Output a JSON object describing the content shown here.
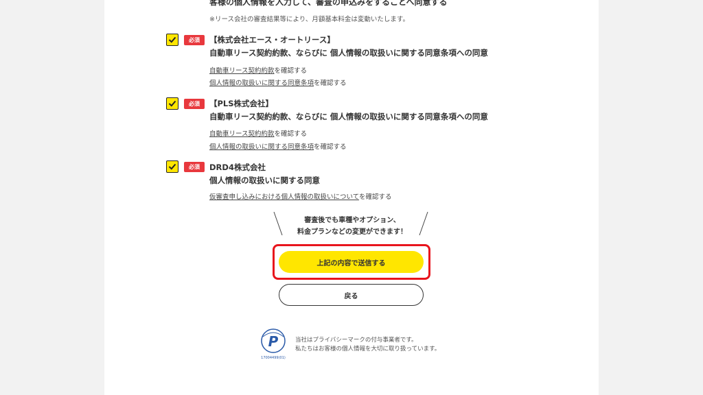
{
  "intro": {
    "line": "客様の個人情報を入力して、審査の申込みをすることへ同意する",
    "note": "※リース会社の審査結果等により、月額基本料金は変動いたします。"
  },
  "agreements": [
    {
      "badge": "必須",
      "company": "【株式会社エース・オートリース】",
      "subject": "自動車リース契約約款、ならびに 個人情報の取扱いに関する同意条項への同意",
      "links": [
        {
          "text": "自動車リース契約約款",
          "suffix": "を確認する"
        },
        {
          "text": "個人情報の取扱いに関する同意条項",
          "suffix": "を確認する"
        }
      ]
    },
    {
      "badge": "必須",
      "company": "【PLS株式会社】",
      "subject": "自動車リース契約約款、ならびに 個人情報の取扱いに関する同意条項への同意",
      "links": [
        {
          "text": "自動車リース契約約款",
          "suffix": "を確認する"
        },
        {
          "text": "個人情報の取扱いに関する同意条項",
          "suffix": "を確認する"
        }
      ]
    },
    {
      "badge": "必須",
      "company": "DRD4株式会社",
      "subject": "個人情報の取扱いに関する同意",
      "links": [
        {
          "text": "仮審査申し込みにおける個人情報の取扱いについて",
          "suffix": "を確認する"
        }
      ]
    }
  ],
  "callout": {
    "line1": "審査後でも車種やオプション、",
    "line2": "料金プランなどの変更ができます！"
  },
  "buttons": {
    "submit": "上記の内容で送信する",
    "back": "戻る"
  },
  "privacy": {
    "line1": "当社はプライバシーマークの付与事業者です。",
    "line2": "私たちはお客様の個人情報を大切に取り扱っています。",
    "mark_number": "17004499(01)"
  },
  "colors": {
    "accent_yellow": "#ffe600",
    "required_red": "#e8383d",
    "highlight_red": "#e8141c"
  }
}
